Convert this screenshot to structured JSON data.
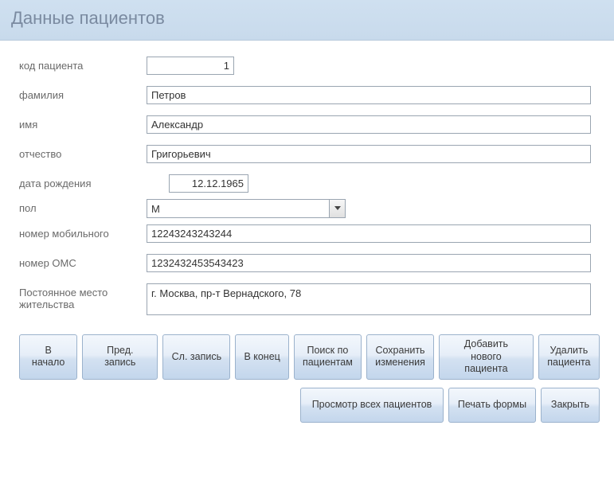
{
  "header": {
    "title": "Данные пациентов"
  },
  "labels": {
    "code": "код пациента",
    "lastname": "фамилия",
    "firstname": "имя",
    "patronymic": "отчество",
    "dob": "дата рождения",
    "gender": "пол",
    "mobile": "номер мобильного",
    "oms": "номер ОМС",
    "address": "Постоянное место жительства"
  },
  "values": {
    "code": "1",
    "lastname": "Петров",
    "firstname": "Александр",
    "patronymic": "Григорьевич",
    "dob": "12.12.1965",
    "gender": "М",
    "mobile": "12243243243244",
    "oms": "1232432453543423",
    "address": "г. Москва, пр-т Вернадского, 78"
  },
  "buttons": {
    "first": "В начало",
    "prev": "Пред. запись",
    "next": "Сл. запись",
    "last": "В конец",
    "search": "Поиск по\nпациентам",
    "save": "Сохранить\nизменения",
    "add": "Добавить нового\nпациента",
    "delete": "Удалить\nпациента",
    "viewall": "Просмотр всех пациентов",
    "print": "Печать формы",
    "close": "Закрыть"
  }
}
